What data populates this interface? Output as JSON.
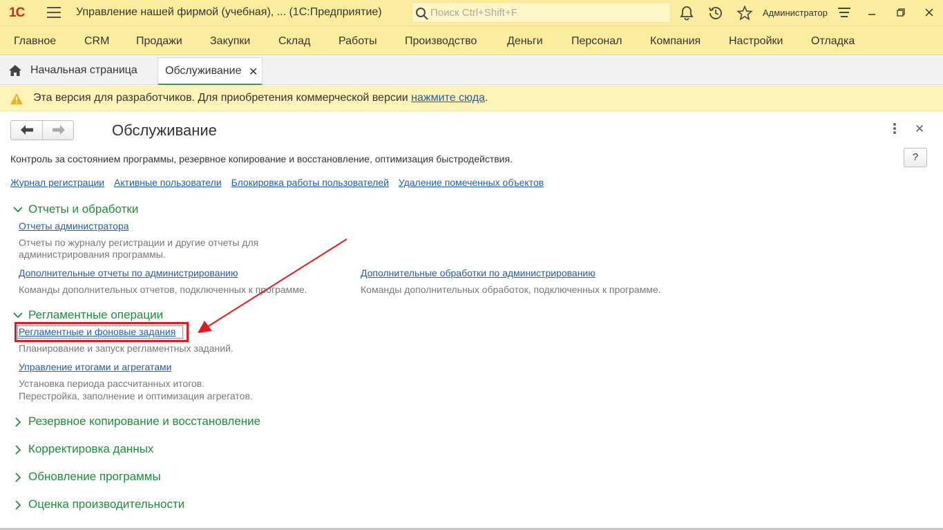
{
  "titlebar": {
    "logo": "1С",
    "app_title": "Управление нашей фирмой (учебная), ...   (1С:Предприятие)",
    "search_placeholder": "Поиск Ctrl+Shift+F",
    "user": "Администратор"
  },
  "menu": [
    "Главное",
    "CRM",
    "Продажи",
    "Закупки",
    "Склад",
    "Работы",
    "Производство",
    "Деньги",
    "Персонал",
    "Компания",
    "Настройки",
    "Отладка"
  ],
  "tabs": {
    "home": "Начальная страница",
    "active": "Обслуживание",
    "close_glyph": "✕"
  },
  "warning": {
    "text": "Эта версия для разработчиков. Для приобретения коммерческой версии ",
    "link": "нажмите сюда",
    "tail": "."
  },
  "form": {
    "title": "Обслуживание",
    "help": "?",
    "close_glyph": "✕",
    "description": "Контроль за состоянием программы, резервное копирование и восстановление, оптимизация быстродействия.",
    "top_links": [
      "Журнал регистрации",
      "Активные пользователи",
      "Блокировка работы пользователей",
      "Удаление помеченных объектов"
    ],
    "groups": {
      "reports": {
        "title": "Отчеты и обработки",
        "admin_reports_link": "Отчеты администратора",
        "admin_reports_note_1": "Отчеты по журналу регистрации и другие отчеты для",
        "admin_reports_note_2": "администрирования программы.",
        "extra_reports_link": "Дополнительные отчеты по администрированию",
        "extra_reports_note": "Команды дополнительных отчетов, подключенных к программе.",
        "extra_processing_link": "Дополнительные обработки по администрированию",
        "extra_processing_note": "Команды дополнительных обработок, подключенных к программе."
      },
      "routine": {
        "title": "Регламентные операции",
        "jobs_link": "Регламентные и фоновые задания",
        "jobs_note": "Планирование и запуск регламентных заданий.",
        "totals_link": "Управление итогами и агрегатами",
        "totals_note_1": "Установка периода рассчитанных итогов.",
        "totals_note_2": "Перестройка, заполнение и оптимизация агрегатов."
      },
      "backup": {
        "title": "Резервное копирование и восстановление"
      },
      "correction": {
        "title": "Корректировка данных"
      },
      "update": {
        "title": "Обновление программы"
      },
      "performance": {
        "title": "Оценка производительности"
      }
    }
  },
  "colors": {
    "header_bg": "#fbed9e",
    "group_green": "#1e8c3a",
    "link_blue": "#1f5ea8",
    "annotation_red": "#e11b1b"
  }
}
